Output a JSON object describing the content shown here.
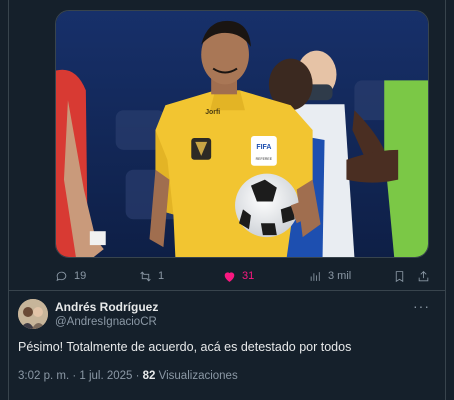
{
  "icons": {
    "reply": "reply-icon",
    "retweet": "retweet-icon",
    "like": "like-icon",
    "views": "views-icon",
    "bookmark": "bookmark-icon",
    "share": "share-icon"
  },
  "colors": {
    "background": "#15202b",
    "like_active": "#f91880",
    "muted": "#8b98a5",
    "text": "#e7e9ea"
  },
  "media": {
    "badge_text": "FIFA",
    "badge_subtext": "REFEREE",
    "brand_text": "Jorfi"
  },
  "actions": {
    "replies": "19",
    "retweets": "1",
    "likes": "31",
    "views": "3 mil"
  },
  "reply": {
    "author_name": "Andrés Rodríguez",
    "handle": "@AndresIgnacioCR",
    "more_label": "···",
    "text": "Pésimo! Totalmente de acuerdo, acá es detestado por todos",
    "timestamp": "3:02 p. m. · 1 jul. 2025 · ",
    "views_count": "82",
    "views_label": " Visualizaciones"
  }
}
